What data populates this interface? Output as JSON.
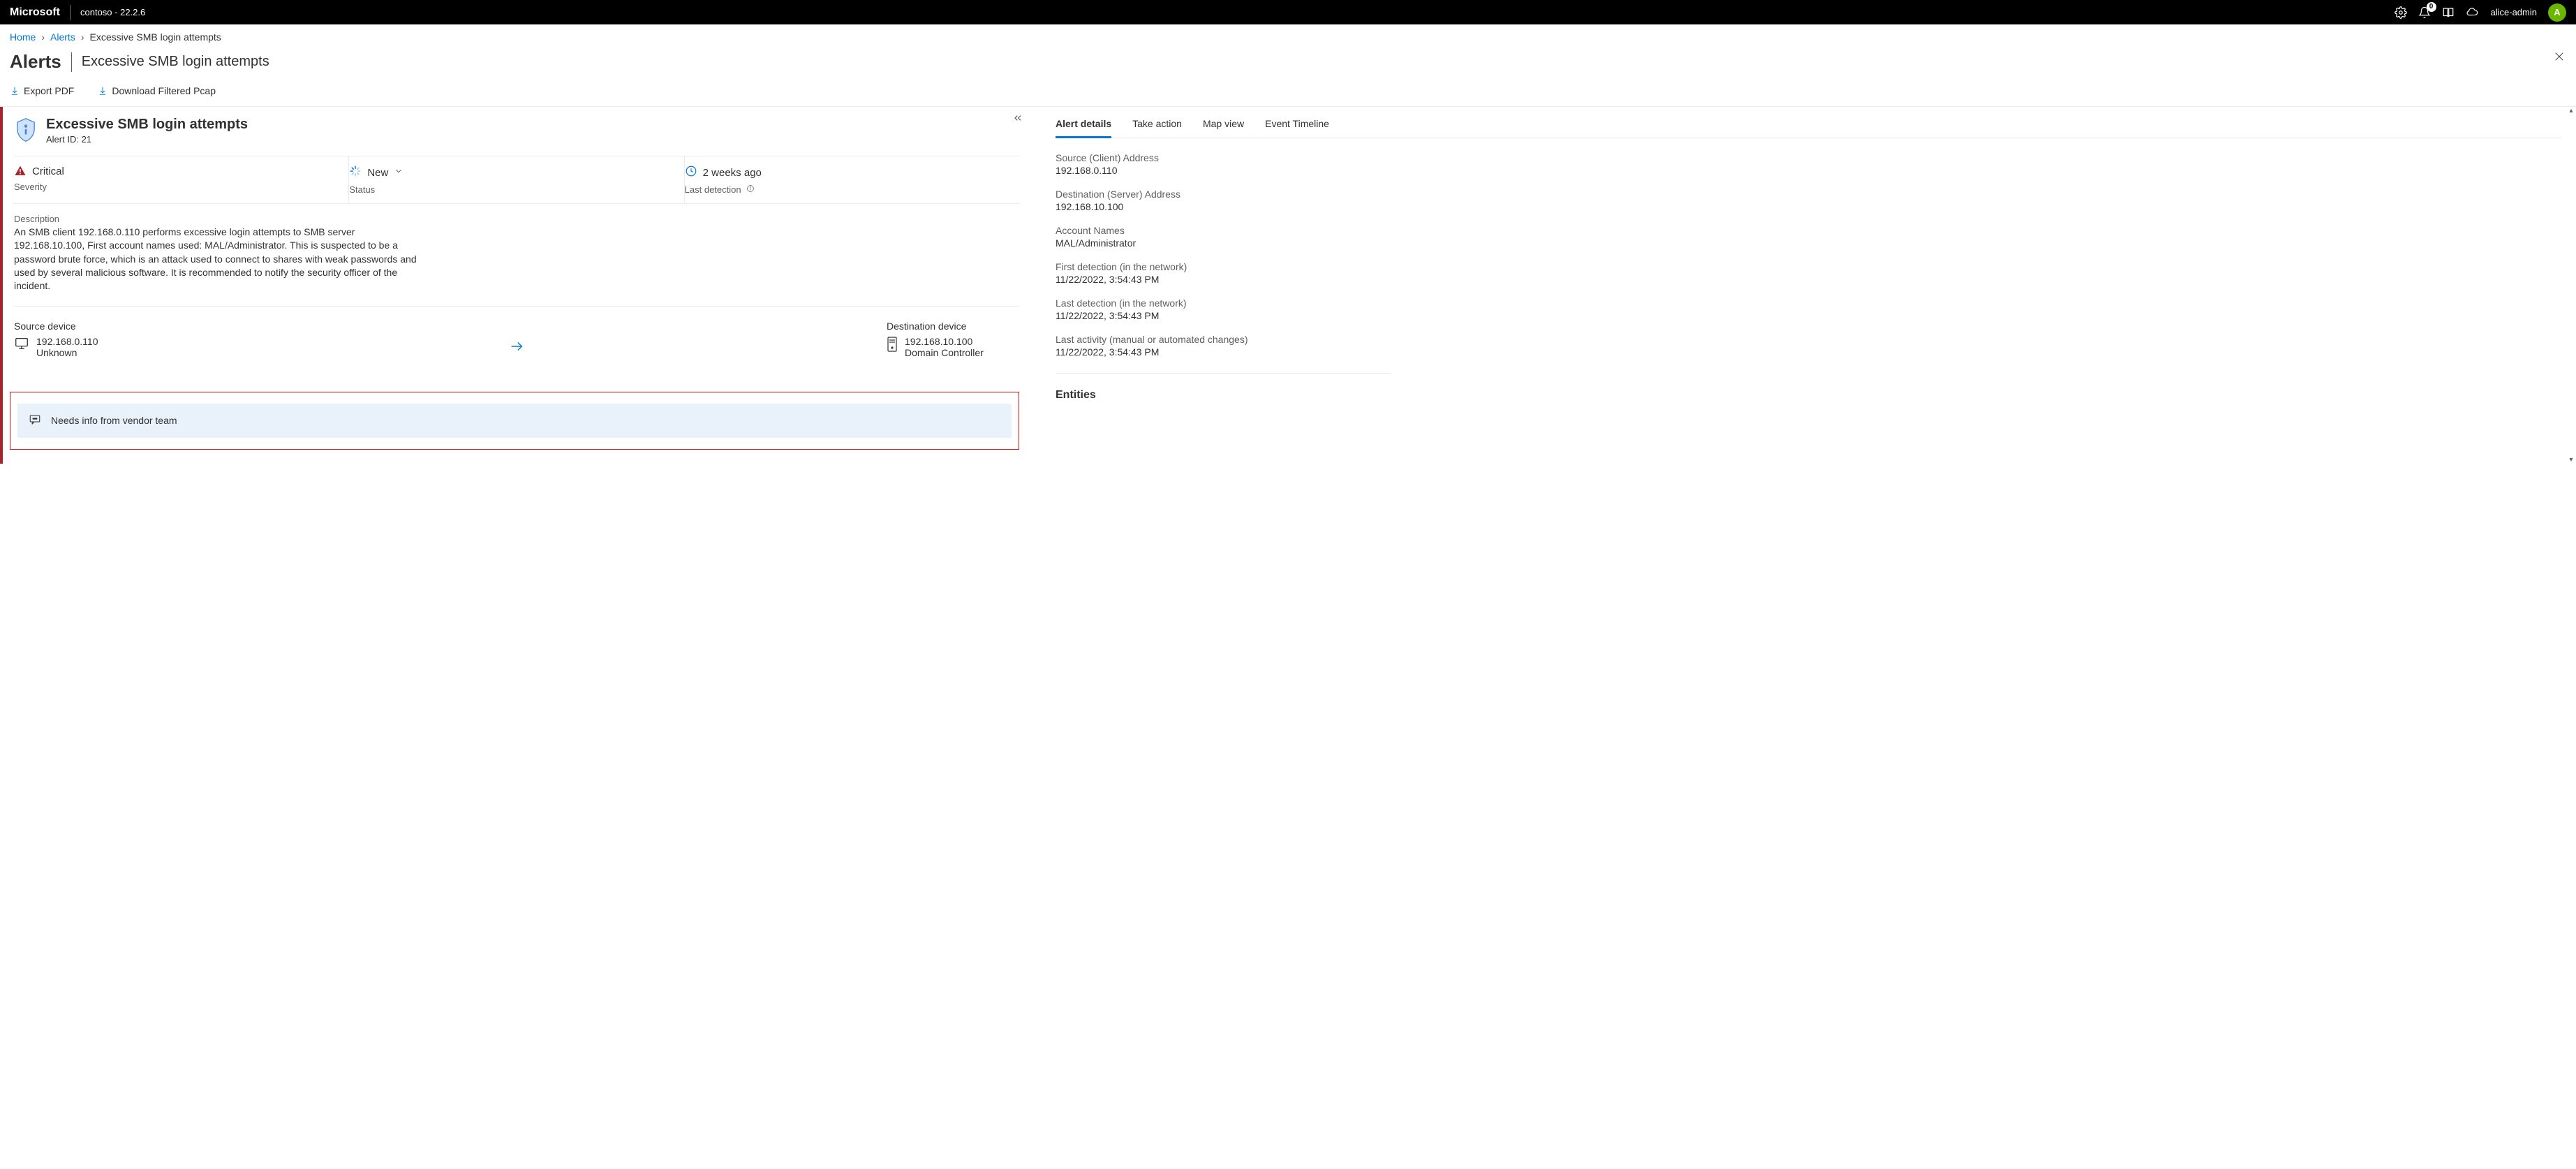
{
  "header": {
    "brand": "Microsoft",
    "tenant": "contoso - 22.2.6",
    "notification_count": "0",
    "user_name": "alice-admin",
    "avatar_initial": "A"
  },
  "breadcrumb": {
    "home": "Home",
    "alerts": "Alerts",
    "current": "Excessive SMB login attempts"
  },
  "page": {
    "section": "Alerts",
    "title": "Excessive SMB login attempts"
  },
  "toolbar": {
    "export_pdf": "Export PDF",
    "download_pcap": "Download Filtered Pcap"
  },
  "alert": {
    "title": "Excessive SMB login attempts",
    "id_label": "Alert ID: 21",
    "severity_value": "Critical",
    "severity_label": "Severity",
    "status_value": "New",
    "status_label": "Status",
    "lastdet_value": "2 weeks ago",
    "lastdet_label": "Last detection",
    "description_label": "Description",
    "description_text": "An SMB client 192.168.0.110 performs excessive login attempts to SMB server 192.168.10.100, First account names used: MAL/Administrator. This is suspected to be a password brute force, which is an attack used to connect to shares with weak passwords and used by several malicious software. It is recommended to notify the security officer of the incident."
  },
  "devices": {
    "source_label": "Source device",
    "source_ip": "192.168.0.110",
    "source_type": "Unknown",
    "dest_label": "Destination device",
    "dest_ip": "192.168.10.100",
    "dest_type": "Domain Controller"
  },
  "comment": {
    "text": "Needs info from vendor team"
  },
  "tabs": {
    "details": "Alert details",
    "take_action": "Take action",
    "map_view": "Map view",
    "timeline": "Event Timeline"
  },
  "details": {
    "source_addr_label": "Source (Client) Address",
    "source_addr_value": "192.168.0.110",
    "dest_addr_label": "Destination (Server) Address",
    "dest_addr_value": "192.168.10.100",
    "account_label": "Account Names",
    "account_value": "MAL/Administrator",
    "first_det_label": "First detection (in the network)",
    "first_det_value": "11/22/2022, 3:54:43 PM",
    "last_det_label": "Last detection (in the network)",
    "last_det_value": "11/22/2022, 3:54:43 PM",
    "last_act_label": "Last activity (manual or automated changes)",
    "last_act_value": "11/22/2022, 3:54:43 PM"
  },
  "entities": {
    "heading": "Entities"
  }
}
